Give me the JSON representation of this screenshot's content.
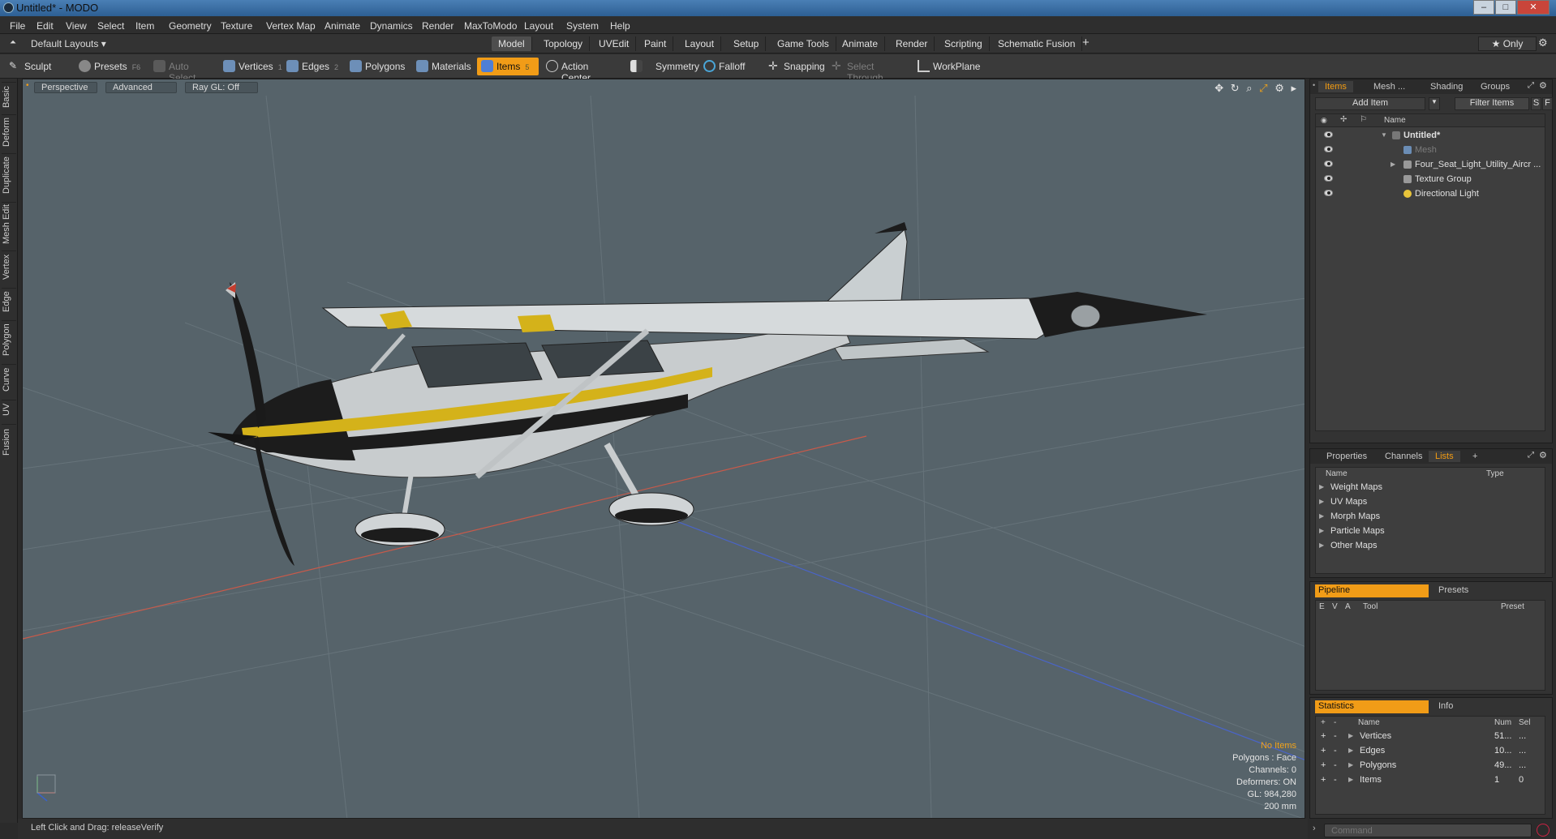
{
  "window": {
    "title": "Untitled* - MODO",
    "controls": [
      "–",
      "□",
      "✕"
    ]
  },
  "menu": [
    "File",
    "Edit",
    "View",
    "Select",
    "Item",
    "Geometry",
    "Texture",
    "Vertex Map",
    "Animate",
    "Dynamics",
    "Render",
    "MaxToModo",
    "Layout",
    "System",
    "Help"
  ],
  "layout_bar": {
    "layouts_label": "Default Layouts ▾",
    "tabs": [
      "Model",
      "Topology",
      "UVEdit",
      "Paint",
      "Layout",
      "Setup",
      "Game Tools",
      "Animate",
      "Render",
      "Scripting",
      "Schematic Fusion"
    ],
    "active_tab": "Model",
    "add": "+",
    "only_label": "★ Only"
  },
  "toolbar": {
    "sculpt": "Sculpt",
    "presets": "Presets",
    "presets_key": "F6",
    "auto_select": "Auto Select",
    "vertices": "Vertices",
    "vertices_key": "1",
    "edges": "Edges",
    "edges_key": "2",
    "polygons": "Polygons",
    "materials": "Materials",
    "items": "Items",
    "items_key": "5",
    "action_center": "Action Center",
    "symmetry": "Symmetry",
    "falloff": "Falloff",
    "snapping": "Snapping",
    "select_through": "Select Through",
    "workplane": "WorkPlane"
  },
  "left_tabs": [
    "Basic",
    "Deform",
    "Duplicate",
    "Mesh Edit",
    "Vertex",
    "Edge",
    "Polygon",
    "Curve",
    "UV",
    "Fusion"
  ],
  "viewport": {
    "perspective": "Perspective",
    "advanced": "Advanced",
    "raygl": "Ray GL: Off",
    "hud": {
      "no_items": "No Items",
      "polygons": "Polygons : Face",
      "channels": "Channels: 0",
      "deformers": "Deformers: ON",
      "gl": "GL: 984,280",
      "scale": "200 mm"
    },
    "colors": {
      "background": "#56636a",
      "grid": "#6a767c",
      "x_axis": "#c85a4a",
      "z_axis": "#4a64c8",
      "stripe_yellow": "#d4b21a",
      "hull_dark": "#1c1c1c"
    }
  },
  "status": {
    "text": "Left Click and Drag:   releaseVerify"
  },
  "items_panel": {
    "tabs": [
      "Items",
      "Mesh ...",
      "Shading",
      "Groups"
    ],
    "active_tab": "Items",
    "add_item": "Add Item",
    "filter_items": "Filter Items",
    "s_btn": "S",
    "f_btn": "F",
    "name_header": "Name",
    "rows": [
      {
        "label": "Untitled*",
        "bold": true
      },
      {
        "label": "Mesh",
        "dim": true
      },
      {
        "label": "Four_Seat_Light_Utility_Aircr ..."
      },
      {
        "label": "Texture Group"
      },
      {
        "label": "Directional Light"
      }
    ]
  },
  "lists_panel": {
    "tabs": [
      "Properties",
      "Channels",
      "Lists",
      "+"
    ],
    "active_tab": "Lists",
    "name_header": "Name",
    "type_header": "Type",
    "rows": [
      "Weight Maps",
      "UV Maps",
      "Morph Maps",
      "Particle Maps",
      "Other Maps"
    ]
  },
  "pipeline_panel": {
    "pipeline": "Pipeline",
    "presets": "Presets",
    "headers": [
      "E",
      "V",
      "A",
      "Tool",
      "Preset"
    ]
  },
  "stats_panel": {
    "statistics": "Statistics",
    "info": "Info",
    "headers": {
      "plus": "+",
      "minus": "-",
      "name": "Name",
      "num": "Num",
      "sel": "Sel"
    },
    "rows": [
      {
        "name": "Vertices",
        "num": "51...",
        "sel": "..."
      },
      {
        "name": "Edges",
        "num": "10...",
        "sel": "..."
      },
      {
        "name": "Polygons",
        "num": "49...",
        "sel": "..."
      },
      {
        "name": "Items",
        "num": "1",
        "sel": "0"
      }
    ]
  },
  "command": {
    "placeholder": "Command"
  }
}
